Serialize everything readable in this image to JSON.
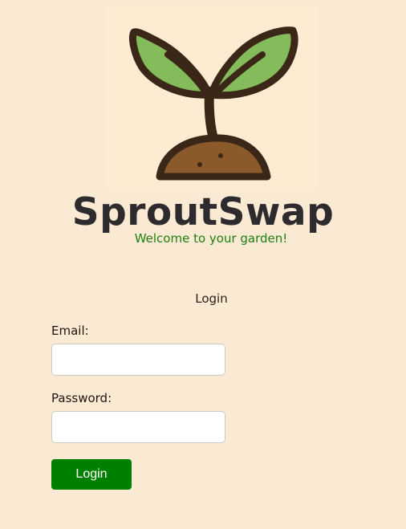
{
  "app": {
    "name": "SproutSwap",
    "tagline": "Welcome to your garden!"
  },
  "logo": {
    "icon": "sprout-logo-icon"
  },
  "login_form": {
    "heading": "Login",
    "email_label": "Email:",
    "email_value": "",
    "password_label": "Password:",
    "password_value": "",
    "submit_label": "Login"
  },
  "colors": {
    "background": "#fae9d3",
    "accent": "#008000",
    "tagline": "#1f7f10",
    "title": "#2d2b2e",
    "leaf": "#84bb5b",
    "soil": "#8b5a2b",
    "outline": "#3b2718"
  }
}
